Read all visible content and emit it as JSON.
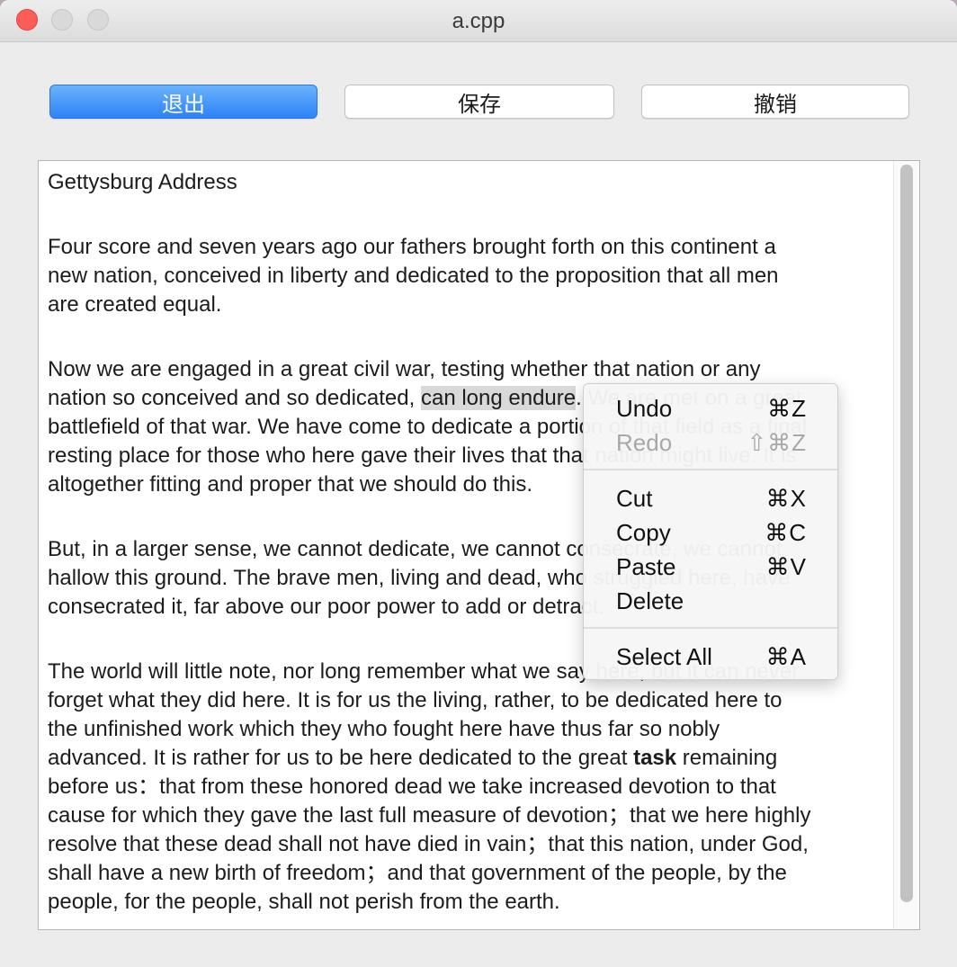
{
  "window": {
    "title": "a.cpp"
  },
  "toolbar": {
    "quit_label": "退出",
    "save_label": "保存",
    "undo_label": "撤销"
  },
  "document": {
    "title": "Gettysburg Address",
    "p1": "Four score and seven years ago our fathers brought forth on this continent a\nnew nation, conceived in liberty and dedicated to the proposition that all men\nare created equal.",
    "p2a": "Now we are engaged in a great civil war, testing whether that nation or any\nnation so conceived and so dedicated, ",
    "p2_selected": "can long endure",
    "p2b": ". We are met on a great\nbattlefield of that war. We have come to dedicate a portion of that field as a final\nresting place for those who here gave their lives that that nation might live. It is\naltogether fitting and proper that we should do this.",
    "p3": "But, in a larger sense, we cannot dedicate, we cannot consecrate, we cannot\nhallow this ground. The brave men, living and dead, who struggled here, have\nconsecrated it, far above our poor power to add or detract.",
    "p4a": "The world will little note, nor long remember what we say here, but it can never\nforget what they did here. It is for us the living, rather, to be dedicated here to\nthe unfinished work which they who fought here have thus far so nobly\nadvanced. It is rather for us to be here dedicated to the great ",
    "p4_bold": "task",
    "p4b": " remaining\nbefore us：that from these honored dead we take increased devotion to that\ncause for which they gave the last full measure of devotion；that we here highly\nresolve that these dead shall not have died in vain；that this nation, under God,\nshall have a new birth of freedom；and that government of the people, by the\npeople, for the people, shall not perish from the earth."
  },
  "context_menu": {
    "undo": {
      "label": "Undo",
      "shortcut": "⌘Z"
    },
    "redo": {
      "label": "Redo",
      "shortcut": "⇧⌘Z"
    },
    "cut": {
      "label": "Cut",
      "shortcut": "⌘X"
    },
    "copy": {
      "label": "Copy",
      "shortcut": "⌘C"
    },
    "paste": {
      "label": "Paste",
      "shortcut": "⌘V"
    },
    "delete": {
      "label": "Delete",
      "shortcut": ""
    },
    "select_all": {
      "label": "Select All",
      "shortcut": "⌘A"
    }
  }
}
